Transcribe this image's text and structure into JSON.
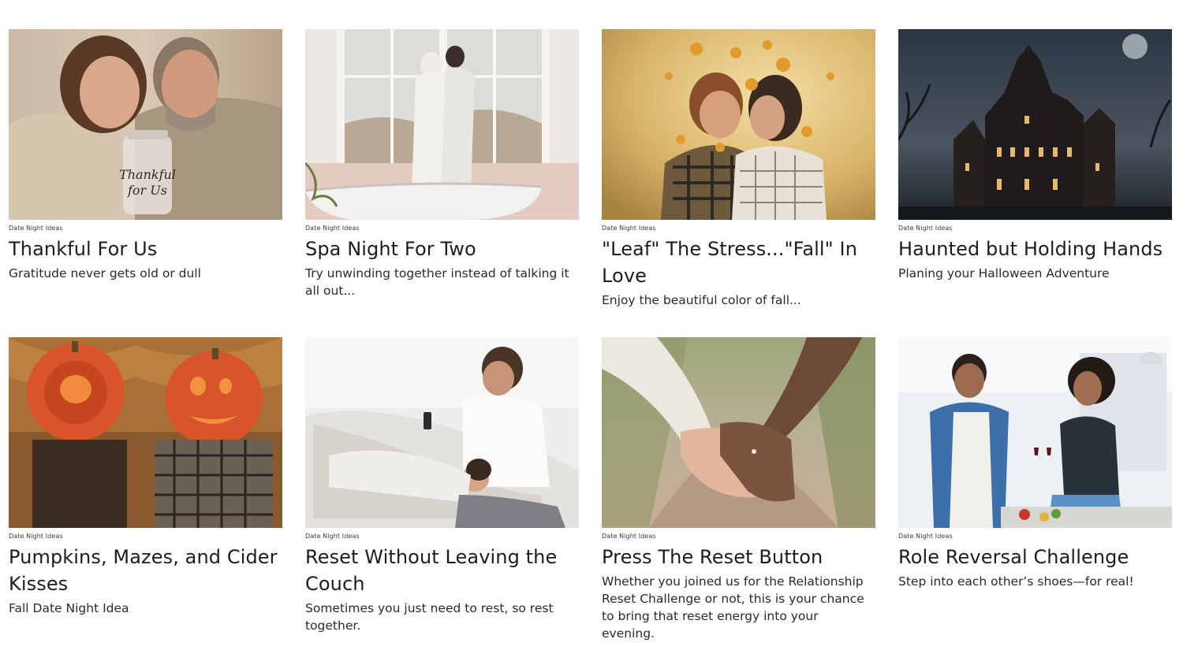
{
  "cards": [
    {
      "category": "Date Night Ideas",
      "title": "Thankful For Us",
      "description": "Gratitude never gets old or dull",
      "image": "couple-with-thankful-jar-photo",
      "jar_text": "Thankful for Us"
    },
    {
      "category": "Date Night Ideas",
      "title": "Spa Night For Two",
      "description": "Try unwinding together instead of talking it all out...",
      "image": "couple-in-robes-by-window-photo"
    },
    {
      "category": "Date Night Ideas",
      "title": "\"Leaf\" The Stress...\"Fall\" In Love",
      "description": "Enjoy the beautiful color of fall...",
      "image": "couple-kissing-autumn-leaves-photo"
    },
    {
      "category": "Date Night Ideas",
      "title": "Haunted but Holding Hands",
      "description": "Planing your Halloween Adventure",
      "image": "haunted-mansion-night-photo"
    },
    {
      "category": "Date Night Ideas",
      "title": "Pumpkins, Mazes, and Cider Kisses",
      "description": "Fall Date Night Idea",
      "image": "carved-pumpkin-heads-photo"
    },
    {
      "category": "Date Night Ideas",
      "title": "Reset Without Leaving the Couch",
      "description": "Sometimes you just need to rest, so rest together.",
      "image": "couple-relaxing-on-couch-photo"
    },
    {
      "category": "Date Night Ideas",
      "title": "Press The Reset Button",
      "description": "Whether you joined us for the Relationship Reset Challenge or not, this is your chance to bring that reset energy into your evening.",
      "image": "holding-hands-path-photo"
    },
    {
      "category": "Date Night Ideas",
      "title": "Role Reversal Challenge",
      "description": "Step into each other’s shoes—for real!",
      "image": "couple-toasting-wine-kitchen-photo"
    }
  ]
}
